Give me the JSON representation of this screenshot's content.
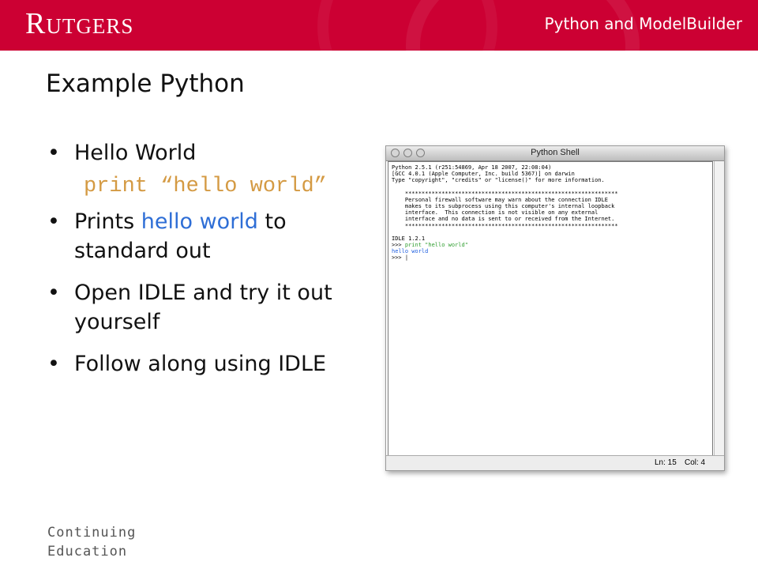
{
  "header": {
    "logo_text": "Rutgers",
    "deck_title": "Python and ModelBuilder",
    "banner_color": "#cc0033"
  },
  "slide": {
    "title": "Example Python",
    "bullet1": "Hello World",
    "code": "print “hello world”",
    "bullet2_pre": "Prints ",
    "bullet2_highlight": "hello world",
    "bullet2_post": " to standard out",
    "bullet3": "Open IDLE and try it out yourself",
    "bullet4": "Follow along using IDLE",
    "bullet_char": "•"
  },
  "footer": {
    "line1": "Continuing",
    "line2": "Education"
  },
  "window": {
    "title": "Python Shell",
    "banner_lines": [
      "Python 2.5.1 (r251:54869, Apr 18 2007, 22:08:04)",
      "[GCC 4.0.1 (Apple Computer, Inc. build 5367)] on darwin",
      "Type \"copyright\", \"credits\" or \"license()\" for more information."
    ],
    "notice_lines": [
      "    ****************************************************************",
      "    Personal firewall software may warn about the connection IDLE",
      "    makes to its subprocess using this computer's internal loopback",
      "    interface.  This connection is not visible on any external",
      "    interface and no data is sent to or received from the Internet.",
      "    ****************************************************************"
    ],
    "idle_version": "IDLE 1.2.1",
    "prompt": ">>> ",
    "command": "print \"hello world\"",
    "output": "hello world",
    "prompt2": ">>> |",
    "line_label": "Ln: 15",
    "col_label": "Col: 4"
  }
}
